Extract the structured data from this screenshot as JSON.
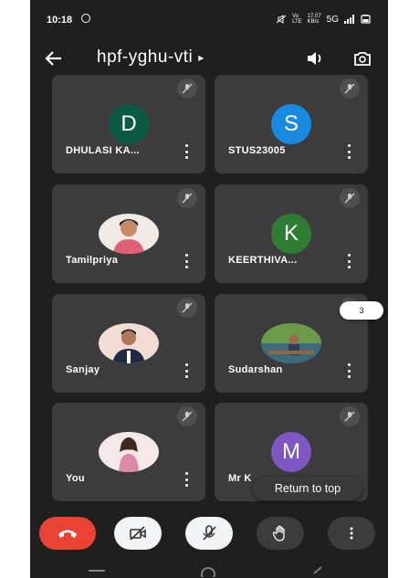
{
  "status": {
    "time": "10:18",
    "speed_top": "17.07",
    "speed_bottom": "KB/s",
    "network": "5G"
  },
  "toolbar": {
    "meeting_code": "hpf-yghu-vti",
    "caret": "▸"
  },
  "tiles": [
    {
      "name": "DHULASI KA...",
      "initial": "D",
      "avatar_color": "#0b5a43"
    },
    {
      "name": "STUS23005",
      "initial": "S",
      "avatar_color": "#1a8ae0"
    },
    {
      "name": "Tamilpriya",
      "initial": ""
    },
    {
      "name": "KEERTHIVA...",
      "initial": "K",
      "avatar_color": "#2e7d32"
    },
    {
      "name": "Sanjay",
      "initial": ""
    },
    {
      "name": "Sudarshan",
      "initial": ""
    },
    {
      "name": "You",
      "initial": ""
    },
    {
      "name": "Mr K",
      "initial": "M",
      "avatar_color": "#7e57c2"
    }
  ],
  "page_indicator": "3",
  "return_to_top": "Return to top",
  "colors": {
    "tile_bg": "#3c3c3c",
    "screen_bg": "#1f1f1f",
    "end_call": "#ea4335"
  }
}
